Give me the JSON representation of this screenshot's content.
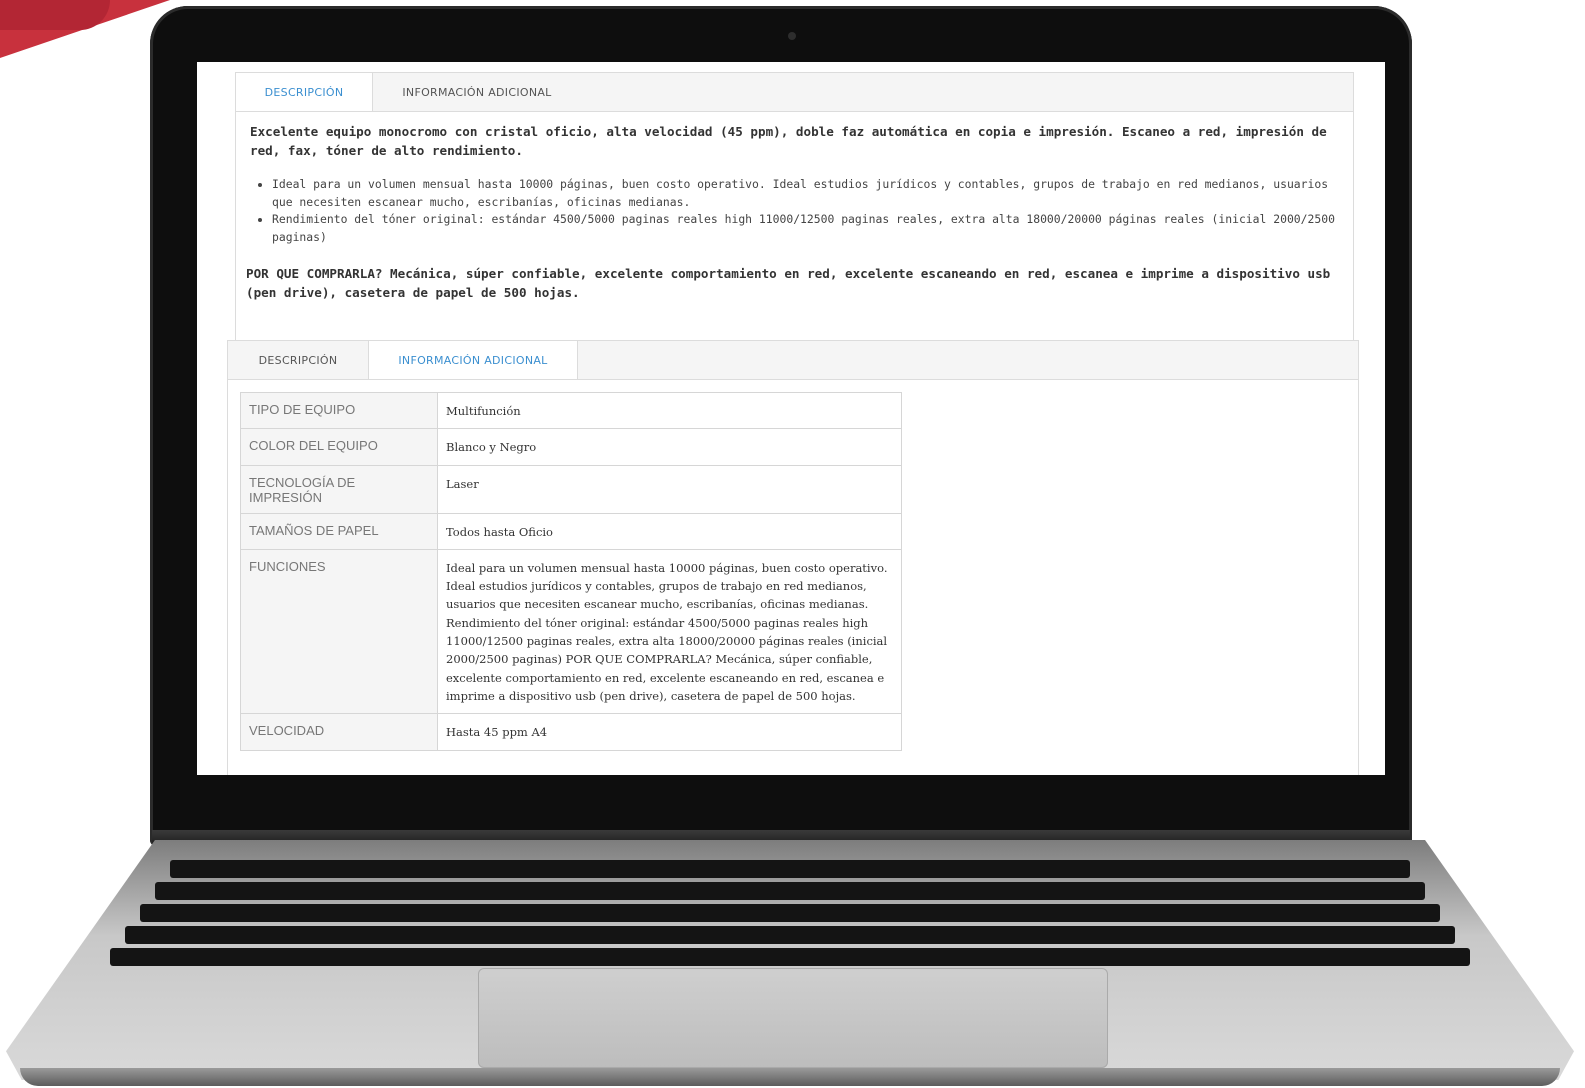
{
  "tabs_top": {
    "descripcion": "DESCRIPCIÓN",
    "info": "INFORMACIÓN ADICIONAL"
  },
  "description": {
    "lead": "Excelente equipo monocromo con cristal oficio, alta velocidad (45 ppm), doble faz automática en copia e impresión. Escaneo a red, impresión de red, fax, tóner de alto rendimiento.",
    "bullets": [
      "Ideal para un volumen mensual hasta 10000 páginas, buen costo operativo. Ideal estudios jurídicos y contables, grupos de trabajo en red medianos, usuarios que necesiten escanear mucho, escribanías, oficinas medianas.",
      "Rendimiento del tóner original: estándar 4500/5000 paginas reales high 11000/12500 paginas reales, extra alta 18000/20000 páginas reales (inicial 2000/2500 paginas)"
    ],
    "why": "POR QUE COMPRARLA? Mecánica, súper confiable, excelente comportamiento en red, excelente escaneando en red, escanea e imprime a dispositivo usb (pen drive), casetera de papel de 500 hojas."
  },
  "tabs_bottom": {
    "descripcion": "DESCRIPCIÓN",
    "info": "INFORMACIÓN ADICIONAL"
  },
  "specs": [
    {
      "label": "TIPO DE EQUIPO",
      "value": "Multifunción"
    },
    {
      "label": "COLOR DEL EQUIPO",
      "value": "Blanco y Negro"
    },
    {
      "label": "TECNOLOGÍA DE IMPRESIÓN",
      "value": "Laser"
    },
    {
      "label": "TAMAÑOS DE PAPEL",
      "value": "Todos hasta Oficio"
    },
    {
      "label": "FUNCIONES",
      "value": "Ideal para un volumen mensual hasta 10000 páginas, buen costo operativo. Ideal estudios jurídicos y contables, grupos de trabajo en red medianos, usuarios que necesiten escanear mucho, escribanías, oficinas medianas. Rendimiento del tóner original: estándar 4500/5000 paginas reales high 11000/12500 paginas reales, extra alta 18000/20000 páginas reales (inicial 2000/2500 paginas) POR QUE COMPRARLA? Mecánica, súper confiable, excelente comportamiento en red, excelente escaneando en red, escanea e imprime a dispositivo usb (pen drive), casetera de papel de 500 hojas."
    },
    {
      "label": "VELOCIDAD",
      "value": "Hasta 45 ppm A4"
    }
  ],
  "colors": {
    "active_tab": "#3b8fd0",
    "brand_red": "#c8313d",
    "accent_orange": "#e8a43c"
  }
}
